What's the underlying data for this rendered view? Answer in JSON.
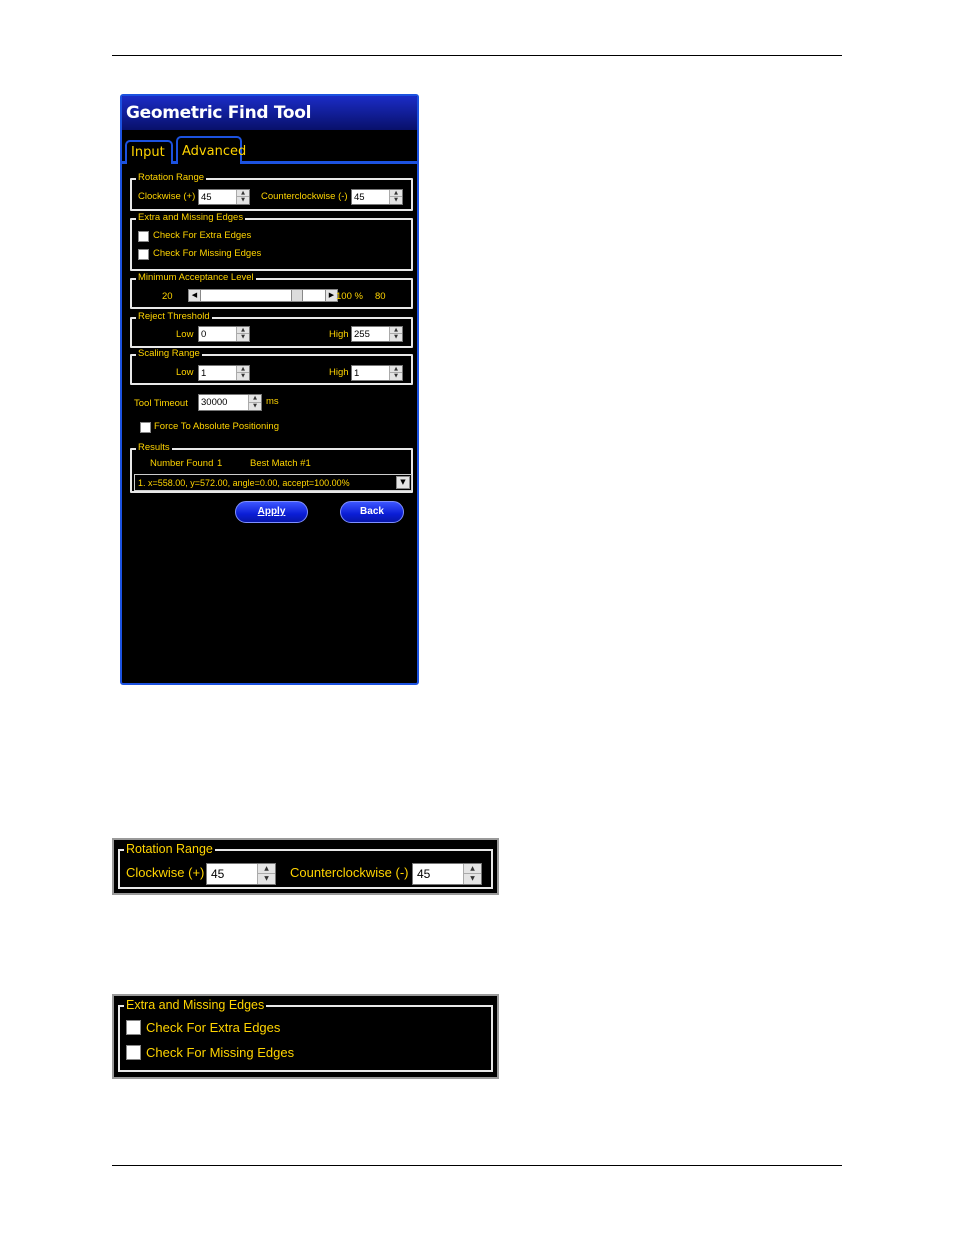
{
  "panel": {
    "title": "Geometric Find Tool",
    "tabs": [
      {
        "label": "Input",
        "active": false
      },
      {
        "label": "Advanced",
        "active": true
      }
    ],
    "rotation_range": {
      "legend": "Rotation Range",
      "clockwise_label": "Clockwise (+)",
      "clockwise_value": "45",
      "counterclockwise_label": "Counterclockwise (-)",
      "counterclockwise_value": "45"
    },
    "edges": {
      "legend": "Extra and Missing Edges",
      "extra_label": "Check For Extra Edges",
      "extra_checked": false,
      "missing_label": "Check For Missing Edges",
      "missing_checked": false
    },
    "acceptance": {
      "legend": "Minimum Acceptance Level",
      "min_label": "20",
      "percent_label": "100 %",
      "value_label": "80",
      "level_fraction": 0.8
    },
    "reject_threshold": {
      "legend": "Reject Threshold",
      "low_label": "Low",
      "low_value": "0",
      "high_label": "High",
      "high_value": "255"
    },
    "scaling_range": {
      "legend": "Scaling Range",
      "low_label": "Low",
      "low_value": "1",
      "high_label": "High",
      "high_value": "1"
    },
    "timeout": {
      "label": "Tool Timeout",
      "value": "30000",
      "unit": "ms"
    },
    "force_absolute": {
      "label": "Force To Absolute Positioning",
      "checked": false
    },
    "results": {
      "legend": "Results",
      "number_found_label": "Number Found",
      "number_found_value": "1",
      "best_match_label": "Best Match #1",
      "selected": "1. x=558.00, y=572.00, angle=0.00, accept=100.00%"
    },
    "apply_label": "Apply",
    "back_label": "Back",
    "colors": {
      "accent": "#1c52e0",
      "label": "#ffd400",
      "button": "#1428e6"
    }
  },
  "zoom_rotation": {
    "legend": "Rotation Range",
    "clockwise_label": "Clockwise (+)",
    "clockwise_value": "45",
    "counterclockwise_label": "Counterclockwise (-)",
    "counterclockwise_value": "45"
  },
  "zoom_edges": {
    "legend": "Extra and Missing Edges",
    "extra_label": "Check For Extra Edges",
    "missing_label": "Check For Missing Edges"
  }
}
